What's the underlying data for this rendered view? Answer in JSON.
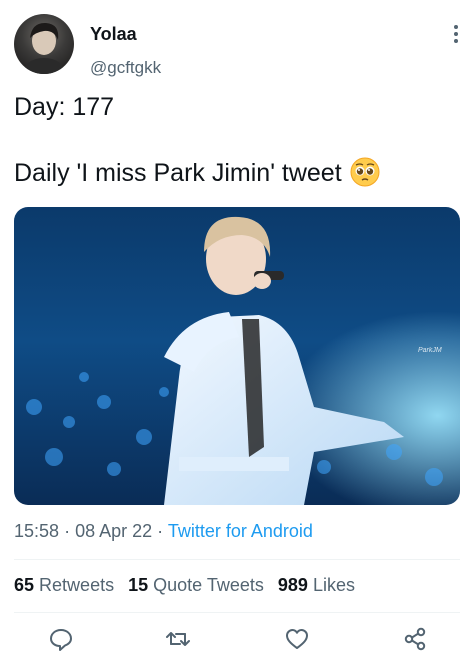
{
  "author": {
    "display_name": "Yolaa",
    "handle": "@gcftgkk"
  },
  "tweet": {
    "line1": "Day: 177",
    "line2": "Daily 'I miss Park Jimin' tweet",
    "emoji": "pleading-face-emoji"
  },
  "media": {
    "watermark": "ParkJM"
  },
  "meta": {
    "time": "15:58",
    "sep1": "·",
    "date": "08 Apr 22",
    "sep2": "·",
    "source": "Twitter for Android"
  },
  "stats": {
    "retweets_count": "65",
    "retweets_label": "Retweets",
    "quotes_count": "15",
    "quotes_label": "Quote Tweets",
    "likes_count": "989",
    "likes_label": "Likes"
  },
  "actions": [
    "reply-icon",
    "retweet-icon",
    "like-icon",
    "share-icon"
  ],
  "colors": {
    "link": "#1d9bf0",
    "secondary_text": "#536471",
    "primary_text": "#0f1419",
    "icon": "#536471"
  }
}
